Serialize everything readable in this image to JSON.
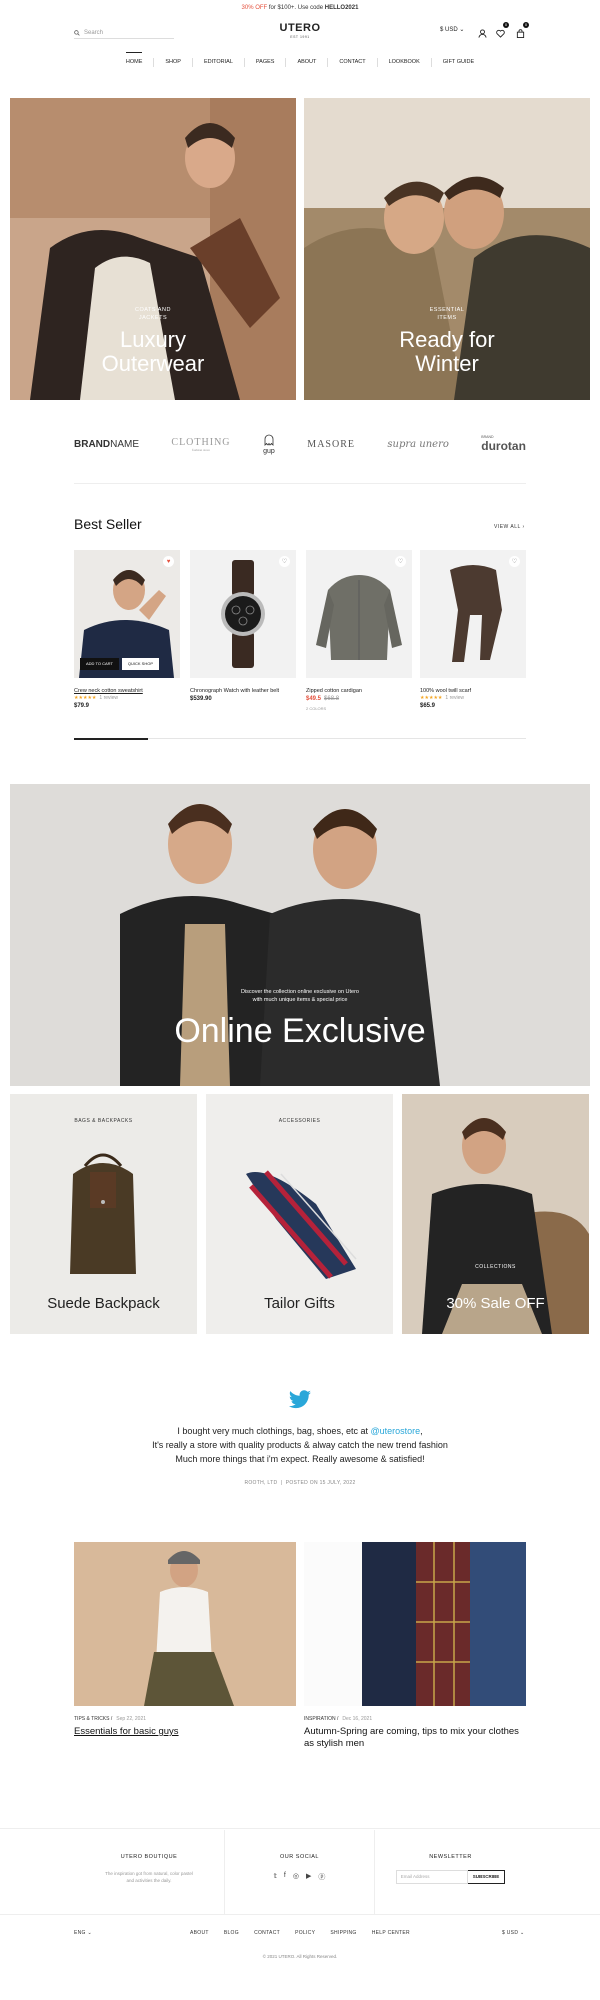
{
  "announcement": {
    "part1": "30% OFF",
    "part2": " for $100+. Use code ",
    "code": "HELLO2021"
  },
  "header": {
    "search_placeholder": "Search",
    "logo": "UTERO",
    "logo_sub": "EST 1991",
    "currency": "$ USD",
    "wishlist_count": "0",
    "cart_count": "0"
  },
  "nav": [
    "HOME",
    "SHOP",
    "EDITORIAL",
    "PAGES",
    "ABOUT",
    "CONTACT",
    "LOOKBOOK",
    "GIFT GUIDE"
  ],
  "heroes": [
    {
      "kicker1": "COATS AND",
      "kicker2": "JACKETS",
      "title1": "Luxury",
      "title2": "Outerwear"
    },
    {
      "kicker1": "ESSENTIAL",
      "kicker2": "ITEMS",
      "title1": "Ready for",
      "title2": "Winter"
    }
  ],
  "brands": {
    "b1a": "BRAND",
    "b1b": "NAME",
    "b2": "CLOTHING",
    "b2sub": "fashion store",
    "b3": "gup",
    "b4": "MASORE",
    "b5": "supra unero",
    "b6": "durotan",
    "b6sub": "BRAND"
  },
  "bestseller": {
    "title": "Best Seller",
    "view_all": "VIEW ALL",
    "add_to_cart": "ADD TO CART",
    "quick_shop": "QUICK SHOP",
    "products": [
      {
        "name": "Crew neck cotton sweatshirt",
        "stars": "★★★★★",
        "reviews": "1 review",
        "price": "$79.9"
      },
      {
        "name": "Chronograph Watch with leather belt",
        "price": "$539.90"
      },
      {
        "name": "Zipped cotton cardigan",
        "price": "$49.5",
        "old_price": "$68.8",
        "note": "2 COLORS"
      },
      {
        "name": "100% wool twill scarf",
        "stars": "★★★★★",
        "reviews": "1 review",
        "price": "$65.9"
      }
    ]
  },
  "banner": {
    "sub1": "Discover the collection online exclusive on Utero",
    "sub2": "with much unique items & special price",
    "title": "Online Exclusive"
  },
  "tiles": [
    {
      "kicker": "BAGS & BACKPACKS",
      "title": "Suede Backpack"
    },
    {
      "kicker": "ACCESSORIES",
      "title": "Tailor Gifts"
    },
    {
      "kicker": "COLLECTIONS",
      "title": "30% Sale OFF"
    }
  ],
  "testimonial": {
    "line1a": "I bought very much clothings, bag, shoes, etc at ",
    "handle": "@uterostore",
    "line1b": ",",
    "line2": "It's really a store with quality products & alway catch the new trend fashion",
    "line3": "Much more things that i'm expect. Really awesome & satisfied!",
    "author": "ROOTH, LTD",
    "posted": "POSTED ON 15 JULY, 2022"
  },
  "blog": [
    {
      "cat": "TIPS & TRICKS",
      "date": "Sep 22, 2021",
      "title": "Essentials for basic guys"
    },
    {
      "cat": "INSPIRATION",
      "date": "Dec 16, 2021",
      "title1": "Autumn-Spring are coming, tips to mix your clothes",
      "title2": "as stylish men"
    }
  ],
  "footer": {
    "col1_title": "UTERO BOUTIQUE",
    "col1_text1": "The inspiration got from natural, color pastel",
    "col1_text2": "and activities the daily.",
    "col2_title": "OUR SOCIAL",
    "col3_title": "NEWSLETTER",
    "email_placeholder": "Email Address",
    "subscribe": "SUBSCRIBE",
    "lang": "ENG",
    "links": [
      "ABOUT",
      "BLOG",
      "CONTACT",
      "POLICY",
      "SHIPPING",
      "HELP CENTER"
    ],
    "currency": "$ USD",
    "copyright": "© 2021 UTERO. All Rights Reserved."
  }
}
